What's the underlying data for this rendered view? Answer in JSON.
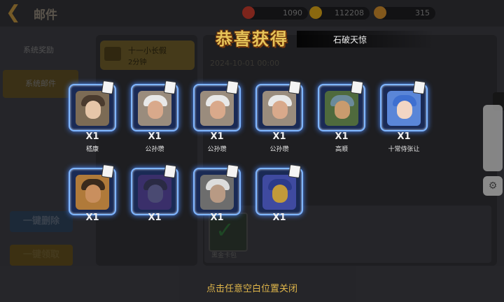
{
  "header": {
    "title": "邮件"
  },
  "resources": [
    {
      "icon": "ruby-icon",
      "value": "1090",
      "color": "#c0392b"
    },
    {
      "icon": "gold-coin-icon",
      "value": "112208",
      "color": "#d4a017"
    },
    {
      "icon": "medal-icon",
      "value": "315",
      "color": "#c8872b"
    }
  ],
  "sidebar": {
    "items": [
      {
        "label": "系统奖励"
      },
      {
        "label": "系统邮件"
      }
    ]
  },
  "mail_list": {
    "items": [
      {
        "title": "十一小长假",
        "time": "2分钟"
      }
    ]
  },
  "detail": {
    "date_partial": "2024-10-01 00:00"
  },
  "attachment": {
    "label": "黑金卡包"
  },
  "buttons": {
    "delete_all": "一键删除",
    "claim_all": "一键领取"
  },
  "popup": {
    "banner_title": "恭喜获得",
    "recipient_name": "石破天惊",
    "close_hint": "点击任意空白位置关闭",
    "rewards": [
      {
        "name": "嵇康",
        "qty": "X1",
        "hair": "#4a3b2e",
        "face": "#e6c6a8",
        "bg": "#7c6b55"
      },
      {
        "name": "公孙瓒",
        "qty": "X1",
        "hair": "#e8e8e8",
        "face": "#d9a98b",
        "bg": "#9a8c7d"
      },
      {
        "name": "公孙瓒",
        "qty": "X1",
        "hair": "#e8e8e8",
        "face": "#d9a98b",
        "bg": "#9a8c7d"
      },
      {
        "name": "公孙瓒",
        "qty": "X1",
        "hair": "#e8e8e8",
        "face": "#d9a98b",
        "bg": "#9a8c7d"
      },
      {
        "name": "高顺",
        "qty": "X1",
        "hair": "#6b8a9a",
        "face": "#c99b6e",
        "bg": "#4f6a3d"
      },
      {
        "name": "十常侍张让",
        "qty": "X1",
        "hair": "#3e6fd0",
        "face": "#f2d6c4",
        "bg": "#5a86d8"
      },
      {
        "name": "",
        "qty": "X1",
        "hair": "#3a2a1c",
        "face": "#c98f5e",
        "bg": "#b07a3a"
      },
      {
        "name": "",
        "qty": "X1",
        "hair": "#2a2a44",
        "face": "#4a4a72",
        "bg": "#3a2f6a"
      },
      {
        "name": "",
        "qty": "X1",
        "hair": "#dcdcdc",
        "face": "#b89a84",
        "bg": "#6d6d6d"
      },
      {
        "name": "",
        "qty": "X1",
        "hair": "#2b3a8a",
        "face": "#c29a3a",
        "bg": "#3f4aa0"
      }
    ]
  }
}
